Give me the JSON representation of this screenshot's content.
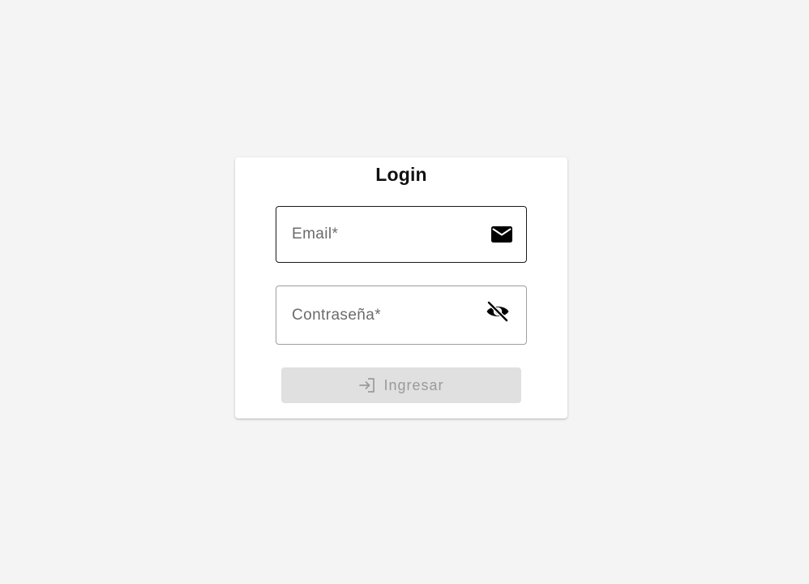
{
  "login": {
    "title": "Login",
    "email": {
      "label": "Email*",
      "value": "",
      "icon": "mail-icon"
    },
    "password": {
      "label": "Contraseña*",
      "value": "",
      "icon": "eye-off-icon"
    },
    "submit": {
      "label": "Ingresar",
      "icon": "login-icon",
      "disabled": true
    }
  },
  "colors": {
    "background": "#f4f4f4",
    "card": "#ffffff",
    "button_disabled_bg": "#e0e0e0",
    "button_disabled_text": "#9a9a9a"
  }
}
